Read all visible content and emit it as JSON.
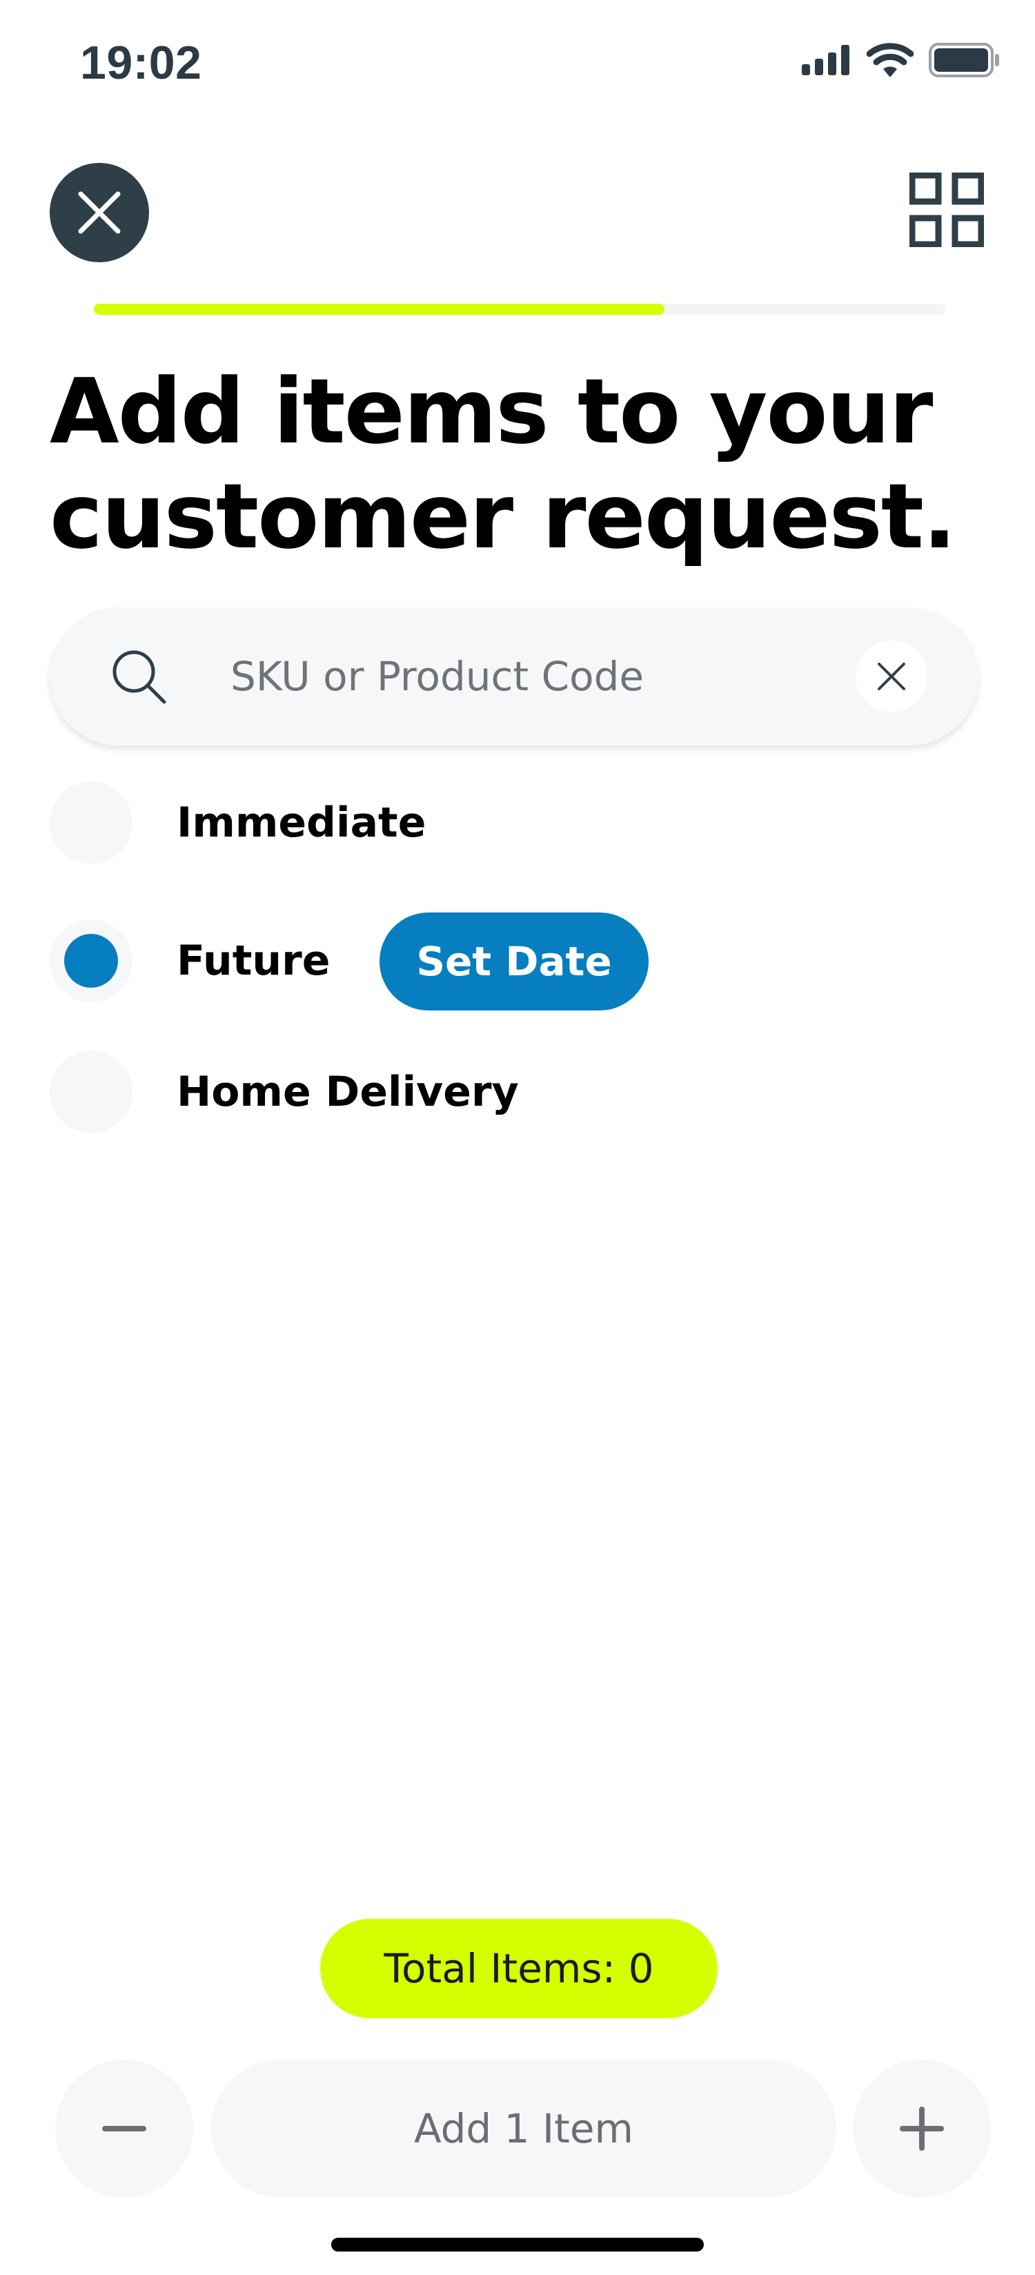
{
  "status_bar": {
    "time": "19:02",
    "icons": [
      "signal-icon",
      "wifi-icon",
      "battery-icon"
    ]
  },
  "header": {
    "close_icon": "close-icon",
    "grid_icon": "grid-icon"
  },
  "progress": {
    "value": 0.67,
    "fill_color": "#d4ff00"
  },
  "title": "Add items to your customer request.",
  "search": {
    "placeholder": "SKU or Product Code",
    "value": ""
  },
  "options": [
    {
      "label": "Immediate",
      "selected": false
    },
    {
      "label": "Future",
      "selected": true
    },
    {
      "label": "Home Delivery",
      "selected": false
    }
  ],
  "set_date_label": "Set Date",
  "total_items_label": "Total Items: 0",
  "stepper": {
    "minus_label": "−",
    "add_label": "Add 1 Item",
    "plus_label": "+"
  },
  "colors": {
    "accent": "#d4ff00",
    "primary": "#067ebf",
    "dark": "#2e3f48"
  }
}
